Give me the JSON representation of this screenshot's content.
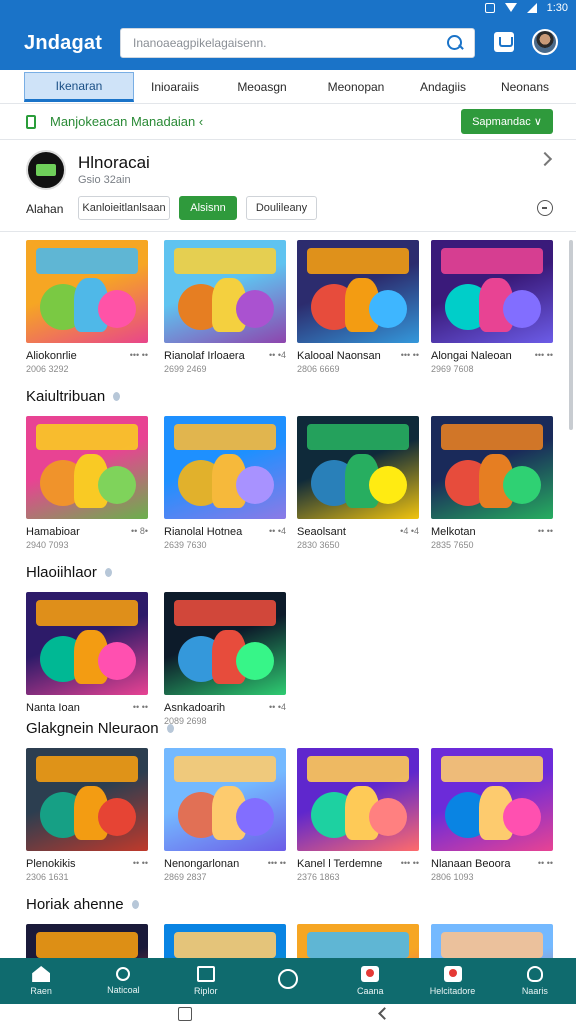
{
  "status_bar": {
    "time": "1:30"
  },
  "app_bar": {
    "title": "Jndagat",
    "search_placeholder": "Inanoaeagpikelagaisenn."
  },
  "tabs": [
    {
      "label": "Ikenaran",
      "active": true
    },
    {
      "label": "Inioaraiis",
      "active": false
    },
    {
      "label": "Meoasgn",
      "active": false
    },
    {
      "label": "Meonopan",
      "active": false
    },
    {
      "label": "Andagiis",
      "active": false
    },
    {
      "label": "Neonans",
      "active": false
    }
  ],
  "promo": {
    "text": "Manjokeacan Manadaian ‹",
    "button_label": "Sapmandac ∨"
  },
  "channel": {
    "name": "Hlnoracai",
    "subtitle": "Gsio 32ain",
    "filter_label": "Alahan",
    "chips": [
      {
        "label": "Kanloieitlanlsaan",
        "style": "outline"
      },
      {
        "label": "Alsisnn",
        "style": "green"
      },
      {
        "label": "Doulileany",
        "style": "outline"
      }
    ]
  },
  "sections": [
    {
      "title": "",
      "cards": [
        {
          "name": "Aliokonrlie",
          "stat": "••• ••",
          "sub": "2006 3292",
          "theme": "candy"
        },
        {
          "name": "Rianolaf Irloaera",
          "stat": "•• •4",
          "sub": "2699 2469",
          "theme": "party"
        },
        {
          "name": "Kalooal Naonsan",
          "stat": "••• ••",
          "sub": "2806 6669",
          "theme": "hero"
        },
        {
          "name": "Alongai Naleoan",
          "stat": "••• ••",
          "sub": "2969 7608",
          "theme": "stage"
        }
      ]
    },
    {
      "title": "Kaiultribuan",
      "cards": [
        {
          "name": "Hamabioar",
          "stat": "•• 8•",
          "sub": "2940 7093",
          "theme": "slime"
        },
        {
          "name": "Rianolal Hotnea",
          "stat": "•• •4",
          "sub": "2639 7630",
          "theme": "dance"
        },
        {
          "name": "Seaolsant",
          "stat": "•4 •4",
          "sub": "2830 3650",
          "theme": "spot"
        },
        {
          "name": "Melkotan",
          "stat": "•• ••",
          "sub": "2835 7650",
          "theme": "cake"
        }
      ]
    },
    {
      "title": "Hlaoiihlaor",
      "cards": [
        {
          "name": "Nanta Ioan",
          "stat": "•• ••",
          "sub": "",
          "theme": "neon"
        },
        {
          "name": "Asnkadoarih",
          "stat": "•• •4",
          "sub": "2089 2698",
          "theme": "laser"
        }
      ]
    },
    {
      "title": "Glakgnein Nleuraon",
      "cards": [
        {
          "name": "Plenokikis",
          "stat": "•• ••",
          "sub": "2306 1631",
          "theme": "crowd"
        },
        {
          "name": "Nenongarlonan",
          "stat": "••• ••",
          "sub": "2869 2837",
          "theme": "cape"
        },
        {
          "name": "Kanel l Terdemne",
          "stat": "••• ••",
          "sub": "2376 1863",
          "theme": "fairy"
        },
        {
          "name": "Nlanaan Beoora",
          "stat": "•• ••",
          "sub": "2806 1093",
          "theme": "king"
        }
      ]
    },
    {
      "title": "Horiak ahenne",
      "cards": [
        {
          "name": "",
          "stat": "",
          "sub": "",
          "theme": "fire"
        },
        {
          "name": "",
          "stat": "",
          "sub": "",
          "theme": "sky"
        },
        {
          "name": "",
          "stat": "",
          "sub": "",
          "theme": "candy"
        },
        {
          "name": "",
          "stat": "",
          "sub": "",
          "theme": "beach"
        }
      ]
    }
  ],
  "bottom_nav": [
    {
      "label": "Raen",
      "icon": "home-icon"
    },
    {
      "label": "Naticoal",
      "icon": "pen-icon"
    },
    {
      "label": "Riplor",
      "icon": "gallery-icon"
    },
    {
      "label": "",
      "icon": "circle-icon"
    },
    {
      "label": "Caana",
      "icon": "camera-icon"
    },
    {
      "label": "Helcitadore",
      "icon": "video-icon"
    },
    {
      "label": "Naaris",
      "icon": "user-icon"
    }
  ],
  "colors": {
    "primary": "#1a73c8",
    "accent_green": "#2f9a3c",
    "nav_bg": "#0f6b6e"
  }
}
